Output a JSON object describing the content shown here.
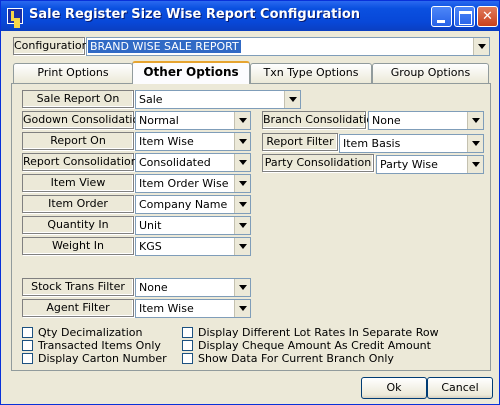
{
  "window": {
    "title": "Sale Register Size Wise Report Configuration"
  },
  "configuration": {
    "label": "Configuration",
    "value": "BRAND WISE SALE REPORT"
  },
  "tabs": [
    {
      "label": "Print Options"
    },
    {
      "label": "Other Options",
      "active": true
    },
    {
      "label": "Txn Type Options"
    },
    {
      "label": "Group Options"
    }
  ],
  "fields": {
    "sale_report_on": {
      "label": "Sale Report On",
      "value": "Sale"
    },
    "godown_consolidation": {
      "label": "Godown Consolidation",
      "value": "Normal"
    },
    "report_on": {
      "label": "Report On",
      "value": "Item Wise"
    },
    "report_consolidation": {
      "label": "Report Consolidation",
      "value": "Consolidated"
    },
    "item_view": {
      "label": "Item View",
      "value": "Item Order Wise"
    },
    "item_order": {
      "label": "Item Order",
      "value": "Company Name"
    },
    "quantity_in": {
      "label": "Quantity In",
      "value": "Unit"
    },
    "weight_in": {
      "label": "Weight In",
      "value": "KGS"
    },
    "branch_consolidation": {
      "label": "Branch Consolidation",
      "value": "None"
    },
    "report_filter": {
      "label": "Report Filter",
      "value": "Item Basis"
    },
    "party_consolidation": {
      "label": "Party Consolidation",
      "value": "Party Wise"
    },
    "stock_trans_filter": {
      "label": "Stock Trans Filter",
      "value": "None"
    },
    "agent_filter": {
      "label": "Agent Filter",
      "value": "Item Wise"
    }
  },
  "checkboxes": {
    "qty_decimalization": {
      "label": "Qty Decimalization",
      "checked": false
    },
    "transacted_items_only": {
      "label": "Transacted Items Only",
      "checked": false
    },
    "display_carton_number": {
      "label": "Display Carton Number",
      "checked": false
    },
    "display_lot_rates": {
      "label": "Display Different Lot Rates In Separate Row",
      "checked": false
    },
    "display_cheque_amount": {
      "label": "Display Cheque Amount As Credit Amount",
      "checked": false
    },
    "show_current_branch": {
      "label": "Show Data For Current Branch Only",
      "checked": false
    }
  },
  "buttons": {
    "ok": "Ok",
    "cancel": "Cancel"
  }
}
